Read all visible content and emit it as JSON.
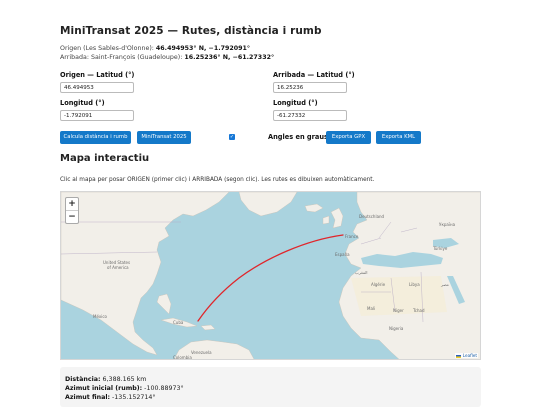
{
  "header": {
    "title": "MiniTransat 2025 — Rutes, distància i rumb",
    "origin_prefix": "Origen (Les Sables-d'Olonne): ",
    "origin_coords": "46.494953° N, −1.792091°",
    "arrival_prefix": "Arribada: Saint-François (Guadeloupe): ",
    "arrival_coords": "16.25236° N, −61.27332°"
  },
  "form": {
    "origin_lat_label": "Origen — Latitud (°)",
    "origin_lat_value": "46.494953",
    "origin_lon_label": "Longitud (°)",
    "origin_lon_value": "-1.792091",
    "arrival_lat_label": "Arribada — Latitud (°)",
    "arrival_lat_value": "16.25236",
    "arrival_lon_label": "Longitud (°)",
    "arrival_lon_value": "-61.27332"
  },
  "actions": {
    "calc_label": "Calcula distància i rumb",
    "preset_label": "MiniTransat 2025",
    "degrees_checkbox_label": "Angles en graus",
    "degrees_checked": true,
    "export_gpx_label": "Exporta GPX",
    "export_kml_label": "Exporta KML"
  },
  "map": {
    "heading": "Mapa interactiu",
    "hint": "Clic al mapa per posar ORIGEN (primer clic) i ARRIBADA (segon clic). Les rutes es dibuixen automàticament.",
    "zoom_in": "+",
    "zoom_out": "−",
    "attribution": "Leaflet",
    "route_color": "#e0262b",
    "ocean_color": "#aad3df",
    "land_color": "#f2efe9",
    "places": {
      "united_states": "United States",
      "of_america": "of America",
      "mexico": "México",
      "cuba": "Cuba",
      "espana": "España",
      "france": "France",
      "deutschland": "Deutschland",
      "algerie": "Algérie",
      "mali": "Mali",
      "niger": "Niger",
      "libya": "Libya",
      "egypt": "مصر",
      "maroc": "المغرب",
      "chad": "Tchad",
      "nigeria": "Nigeria",
      "venezuela": "Venezuela",
      "colombia": "Colombia",
      "ukraine": "Україна",
      "turkiye": "Türkiye"
    }
  },
  "results": {
    "distance_label": "Distància:",
    "distance_value": " 6,388.165 km",
    "initial_label": "Azimut inicial (rumb):",
    "initial_value": " -100.88973°",
    "final_label": "Azimut final:",
    "final_value": " -135.152714°"
  }
}
